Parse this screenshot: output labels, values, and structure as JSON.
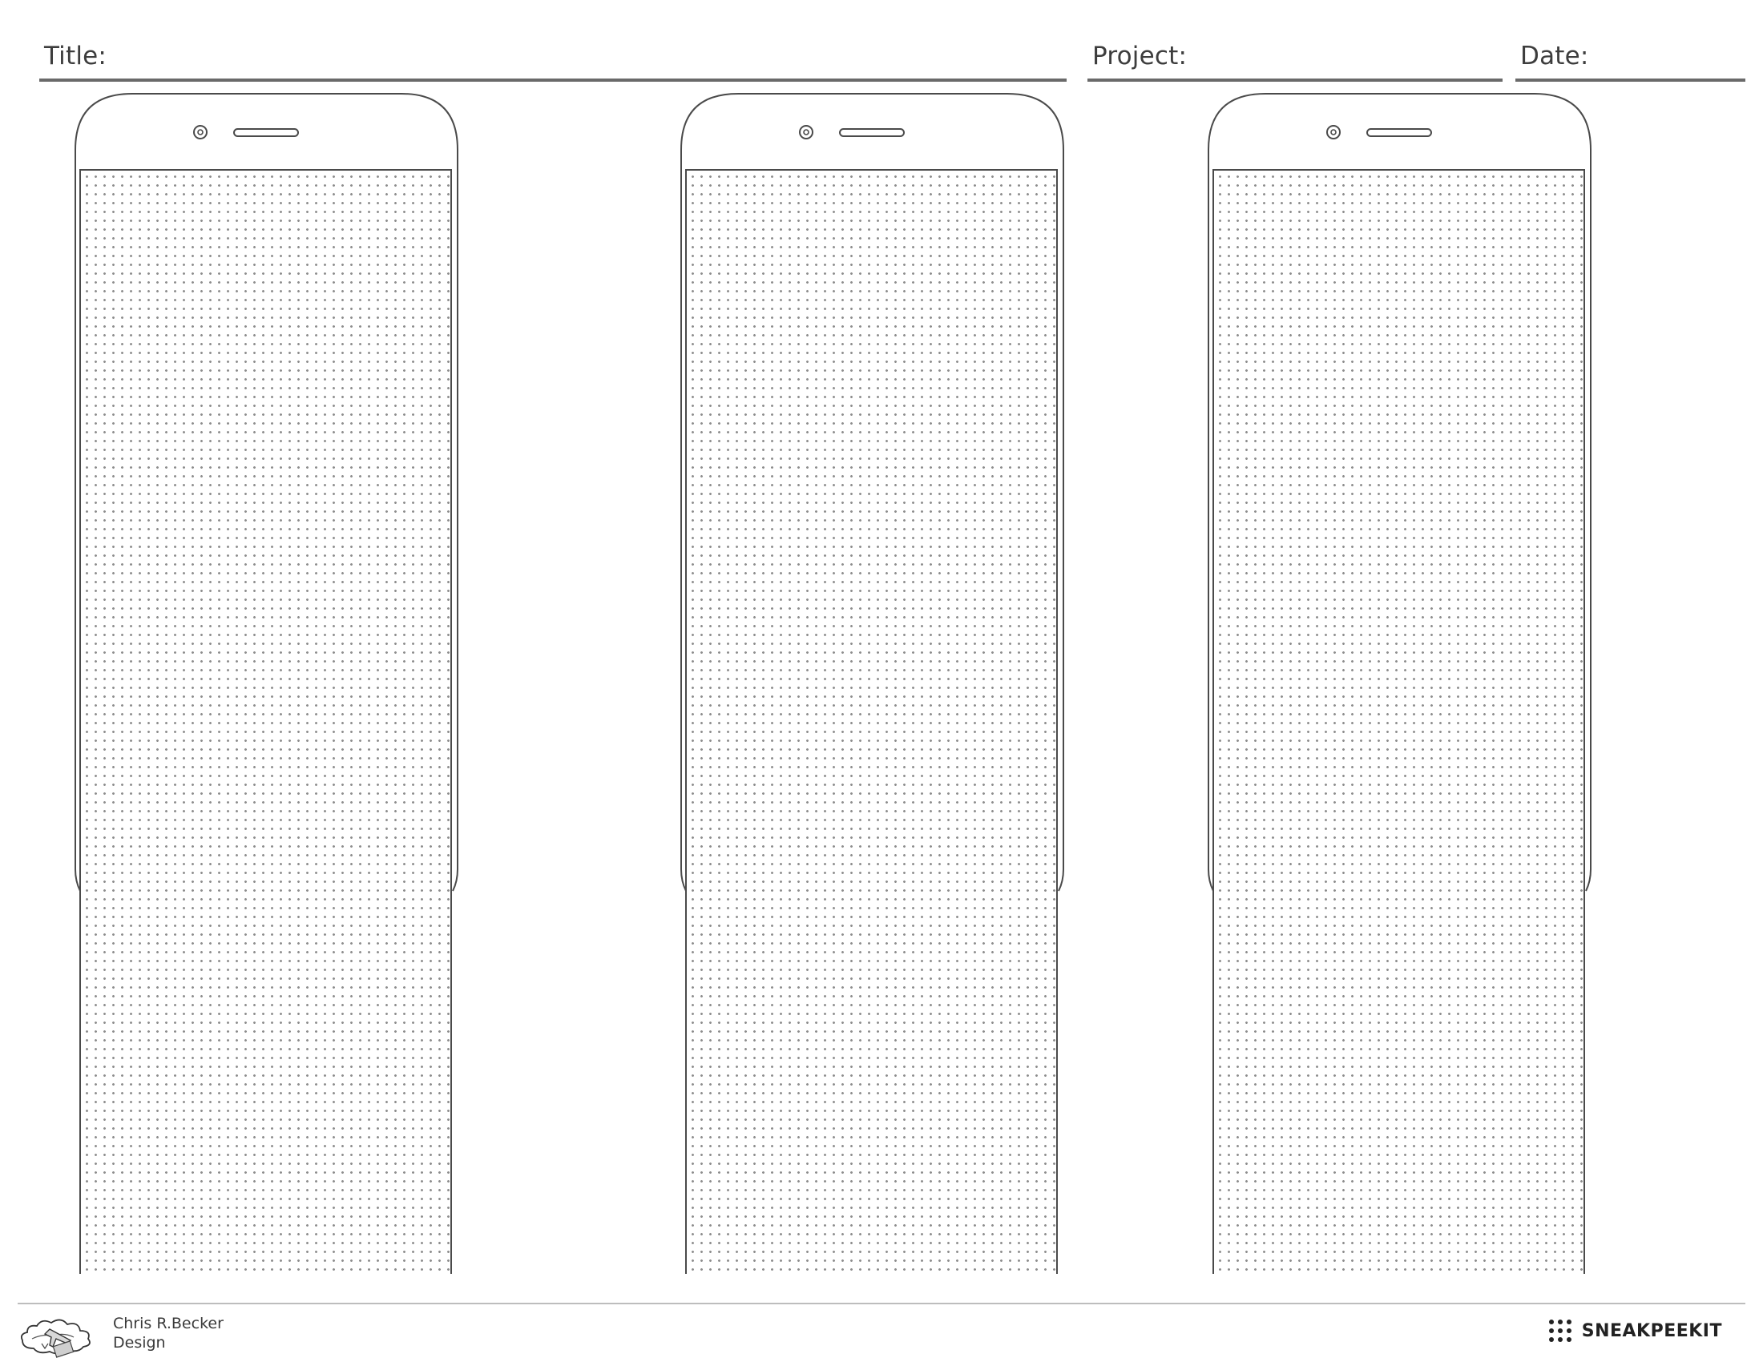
{
  "header": {
    "title_label": "Title:",
    "project_label": "Project:",
    "date_label": "Date:"
  },
  "phones": [
    {
      "icons": [
        "camera-icon",
        "speaker-icon"
      ]
    },
    {
      "icons": [
        "camera-icon",
        "speaker-icon"
      ]
    },
    {
      "icons": [
        "camera-icon",
        "speaker-icon"
      ]
    }
  ],
  "footer": {
    "author_line_1": "Chris R.Becker",
    "author_line_2": "Design",
    "brand": "SNEAKPEEKIT",
    "logo_icon": "cloud-airplane-logo-icon",
    "brand_icon": "dot-grid-icon"
  },
  "colors": {
    "outline": "#4a4a4a",
    "rule": "#6a6a6a",
    "dots": "#8e8e8e",
    "text": "#3a3a3a"
  }
}
